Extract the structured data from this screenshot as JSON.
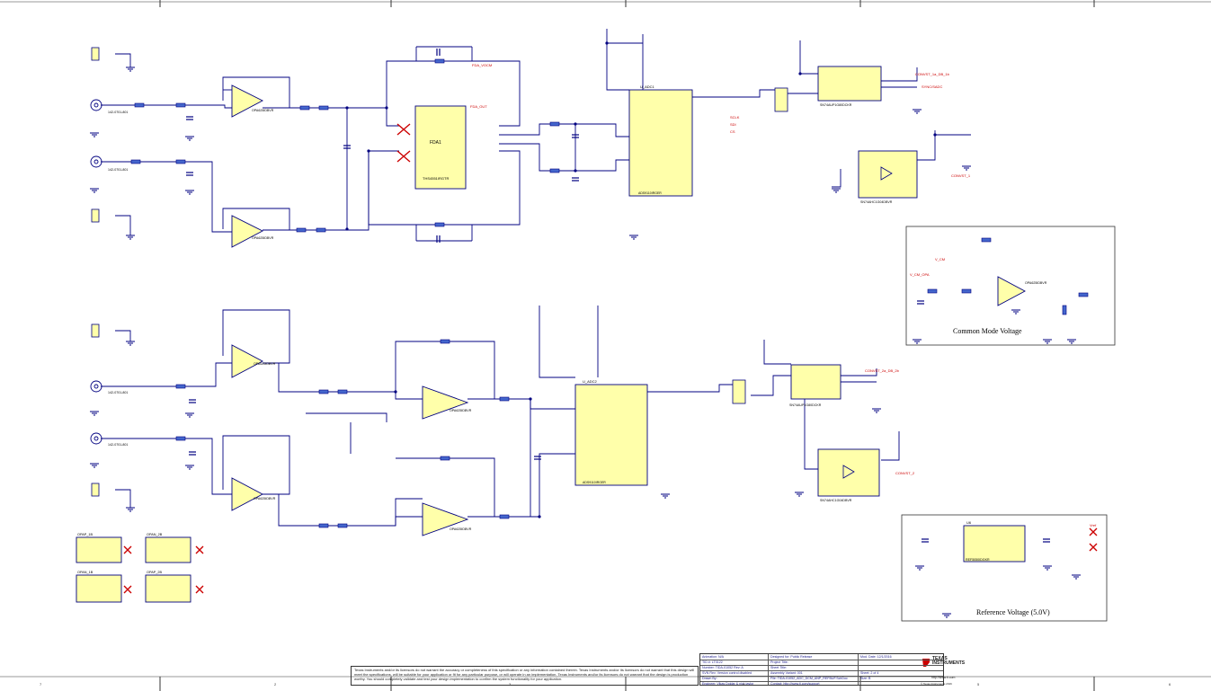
{
  "boxes": {
    "common_mode": {
      "title": "Common Mode Voltage"
    },
    "reference": {
      "title": "Reference Voltage (5.0V)"
    }
  },
  "nets": {
    "fda_out": "FDA_OUT",
    "fda_vocm": "FDA_VOCM",
    "convst_1": "CONVST_1",
    "convst_2": "CONVST_2",
    "convst_ti_1": "CONVST_1a_DB_1b",
    "convst_ti_2": "CONVST_2a_DB_2b",
    "sclk": "SCLK",
    "sdi": "SDI",
    "cs": "CS",
    "sync": "SYNC/SADC",
    "vcm": "V_CM",
    "vcm_opa": "V_CM_OPA",
    "vref": "Vref"
  },
  "refs": {
    "adc1": "ADS9110IRGER",
    "adc1_ref": "U_ADC1",
    "adc2": "ADS9110IRGER",
    "adc2_ref": "U_ADC2",
    "fda": "THS4551IRGTR",
    "fda_ref": "FDA1",
    "opa_a": "OPA625IDBVR",
    "opa_b": "OPA625IDBVR",
    "opa_c": "OPA625IDBVR",
    "opa_d": "OPA625IDBVR",
    "opa_e": "OPA625IDBVR",
    "opa_f": "OPA625IDBVR",
    "cm_amp": "OPA625IDBVR",
    "buf1": "SN74AUP1G80DCKR",
    "buf2": "SN74AHC1G04DBVR",
    "buf3": "SN74AUP1G80DCKR",
    "buf4": "SN74AHC1G04DBVR",
    "ref": "REF5050IDGKR",
    "ref_ref": "U6",
    "sma": "142-0701-801",
    "jumper": "5-146280-3",
    "hdr": "61300311121"
  },
  "fixtures": {
    "f1": "OPAP_1B",
    "f2": "OPAN_2B",
    "f3": "OPAN_1B",
    "f4": "OPAP_2B"
  },
  "disclaimer": "Texas Instruments and/or its licensors do not warrant the accuracy or completeness of this specification or any information contained therein. Texas Instruments and/or its licensors do not warrant that this design will meet the specifications, will be suitable for your application or fit for any particular purpose, or will operate in an implementation. Texas Instruments and/or its licensors do not warrant that the design is production worthy. You should completely validate and test your design implementation to confirm the system functionality for your application.",
  "title_block": {
    "animation_label": "Animation:",
    "animation_value": "N/A",
    "tid_label": "TID #:",
    "tid_value": "LT0122",
    "number_label": "Number:",
    "number_value": "TIDA-01052",
    "rev_label": "Rev:",
    "rev_value": "A",
    "svn_label": "SVN Rev:",
    "svn_value": "Version control disabled",
    "drawn_by_label": "Drawn By:",
    "engineer_label": "Engineer:",
    "engineer_value": "Vikas Doidar & nick.taylor",
    "designed_for_label": "Designed for:",
    "designed_for_value": "Public Release",
    "project_title_label": "Project Title:",
    "sheet_title_label": "Sheet Title:",
    "assembly_variant_label": "Assembly Variant:",
    "assembly_variant_value": "001",
    "file_label": "File:",
    "file_value": "TIDA-01052_ADC_DCM_ANP_REFBUF.SchDoc",
    "contact_label": "Contact:",
    "contact_value": "http://www.ti.com/support",
    "mod_date_label": "Mod. Date:",
    "mod_date_value": "12/1/2016",
    "sheet_label": "Sheet:",
    "sheet_value": "2",
    "of_label": "of",
    "of_value": "4",
    "size_label": "Size:",
    "size_value": "B",
    "logo": "TEXAS INSTRUMENTS",
    "url": "http://www.ti.com",
    "copyright": "© Texas Instruments 2016"
  },
  "zones_bottom": [
    "7",
    "2",
    "3",
    "4",
    "5",
    "6"
  ],
  "colors": {
    "wire": "#000080",
    "part_fill": "#ffffaa",
    "net_red": "#cc0000",
    "text": "#1a1a8a"
  }
}
